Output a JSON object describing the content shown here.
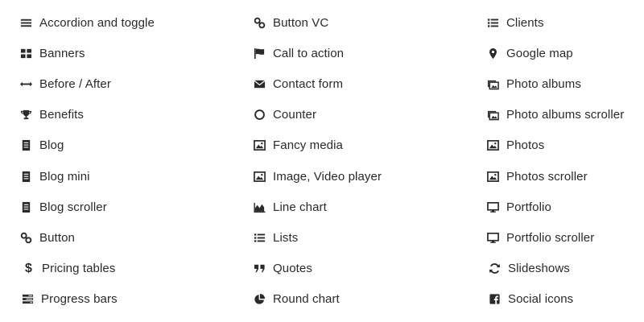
{
  "columns": [
    {
      "items": [
        {
          "label": "Accordion and toggle",
          "icon": "bars-icon"
        },
        {
          "label": "Banners",
          "icon": "grid-icon"
        },
        {
          "label": "Before / After",
          "icon": "arrows-horizontal-icon"
        },
        {
          "label": "Benefits",
          "icon": "trophy-icon"
        },
        {
          "label": "Blog",
          "icon": "document-icon"
        },
        {
          "label": "Blog mini",
          "icon": "document-icon"
        },
        {
          "label": "Blog scroller",
          "icon": "document-icon"
        },
        {
          "label": "Button",
          "icon": "link-icon"
        },
        {
          "label": "Pricing tables",
          "icon": "dollar-icon"
        },
        {
          "label": "Progress bars",
          "icon": "tasks-icon"
        }
      ]
    },
    {
      "items": [
        {
          "label": "Button VC",
          "icon": "link-icon"
        },
        {
          "label": "Call to action",
          "icon": "flag-icon"
        },
        {
          "label": "Contact form",
          "icon": "envelope-icon"
        },
        {
          "label": "Counter",
          "icon": "circle-icon"
        },
        {
          "label": "Fancy media",
          "icon": "image-icon"
        },
        {
          "label": "Image, Video player",
          "icon": "image-icon"
        },
        {
          "label": "Line chart",
          "icon": "area-chart-icon"
        },
        {
          "label": "Lists",
          "icon": "list-icon"
        },
        {
          "label": "Quotes",
          "icon": "quote-icon"
        },
        {
          "label": "Round chart",
          "icon": "pie-chart-icon"
        }
      ]
    },
    {
      "items": [
        {
          "label": "Clients",
          "icon": "list-icon"
        },
        {
          "label": "Google map",
          "icon": "map-marker-icon"
        },
        {
          "label": "Photo albums",
          "icon": "photo-album-icon"
        },
        {
          "label": "Photo albums scroller",
          "icon": "photo-album-icon"
        },
        {
          "label": "Photos",
          "icon": "image-icon"
        },
        {
          "label": "Photos scroller",
          "icon": "image-icon"
        },
        {
          "label": "Portfolio",
          "icon": "monitor-icon"
        },
        {
          "label": "Portfolio scroller",
          "icon": "monitor-icon"
        },
        {
          "label": "Slideshows",
          "icon": "refresh-icon"
        },
        {
          "label": "Social icons",
          "icon": "facebook-icon"
        }
      ]
    }
  ]
}
